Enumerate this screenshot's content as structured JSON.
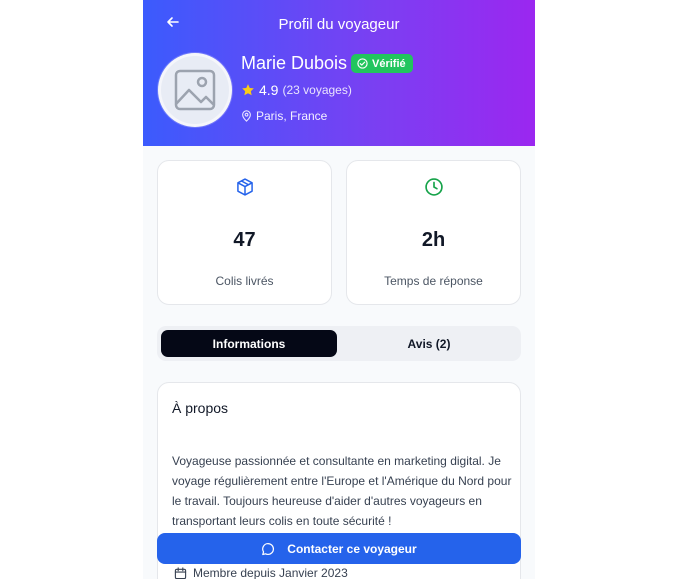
{
  "header": {
    "title": "Profil du voyageur",
    "back_icon": "arrow-left-icon",
    "gradient": [
      "#3b5bfd",
      "#9b27f0"
    ]
  },
  "profile": {
    "name": "Marie Dubois",
    "verified_label": "Vérifié",
    "rating_value": "4.9",
    "rating_count": "(23 voyages)",
    "location": "Paris, France",
    "avatar_icon": "image-placeholder-icon"
  },
  "stats": [
    {
      "icon": "package-icon",
      "value": "47",
      "label": "Colis livrés",
      "icon_color": "#2563eb"
    },
    {
      "icon": "clock-icon",
      "value": "2h",
      "label": "Temps de réponse",
      "icon_color": "#16a34a"
    }
  ],
  "tabs": [
    {
      "label": "Informations",
      "active": true
    },
    {
      "label": "Avis (2)",
      "active": false
    }
  ],
  "about": {
    "title": "À propos",
    "text": "Voyageuse passionnée et consultante en marketing digital. Je voyage régulièrement entre l'Europe et l'Amérique du Nord pour le travail. Toujours heureuse d'aider d'autres voyageurs en transportant leurs colis en toute sécurité !",
    "member_since": "Membre depuis Janvier 2023"
  },
  "cta": {
    "label": "Contacter ce voyageur",
    "icon": "message-circle-icon",
    "color": "#2563eb"
  },
  "colors": {
    "verified": "#22c55e",
    "star": "#facc15",
    "tab_active": "#050816"
  }
}
